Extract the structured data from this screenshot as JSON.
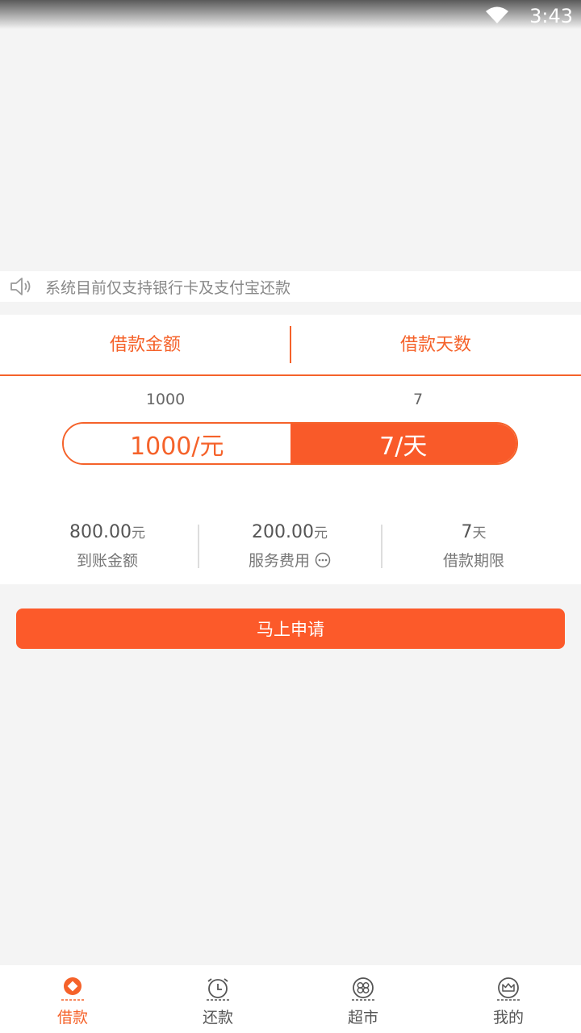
{
  "status_bar": {
    "time": "3:43"
  },
  "notice": {
    "text": "系统目前仅支持银行卡及支付宝还款"
  },
  "tabs": {
    "amount": "借款金额",
    "days": "借款天数"
  },
  "selected": {
    "amount_value": "1000",
    "days_value": "7"
  },
  "toggle": {
    "amount_label": "1000/元",
    "days_label": "7/天"
  },
  "stats": [
    {
      "num": "800.00",
      "unit": "元",
      "label": "到账金额"
    },
    {
      "num": "200.00",
      "unit": "元",
      "label": "服务费用"
    },
    {
      "num": "7",
      "unit": "天",
      "label": "借款期限"
    }
  ],
  "apply_button": "马上申请",
  "bottom_nav": [
    {
      "label": "借款",
      "icon": "loan-icon",
      "active": true
    },
    {
      "label": "还款",
      "icon": "alarm-clock-icon",
      "active": false
    },
    {
      "label": "超市",
      "icon": "market-icon",
      "active": false
    },
    {
      "label": "我的",
      "icon": "crown-icon",
      "active": false
    }
  ],
  "colors": {
    "accent": "#f5622a",
    "button": "#fc5a2a",
    "background": "#f4f4f4"
  }
}
